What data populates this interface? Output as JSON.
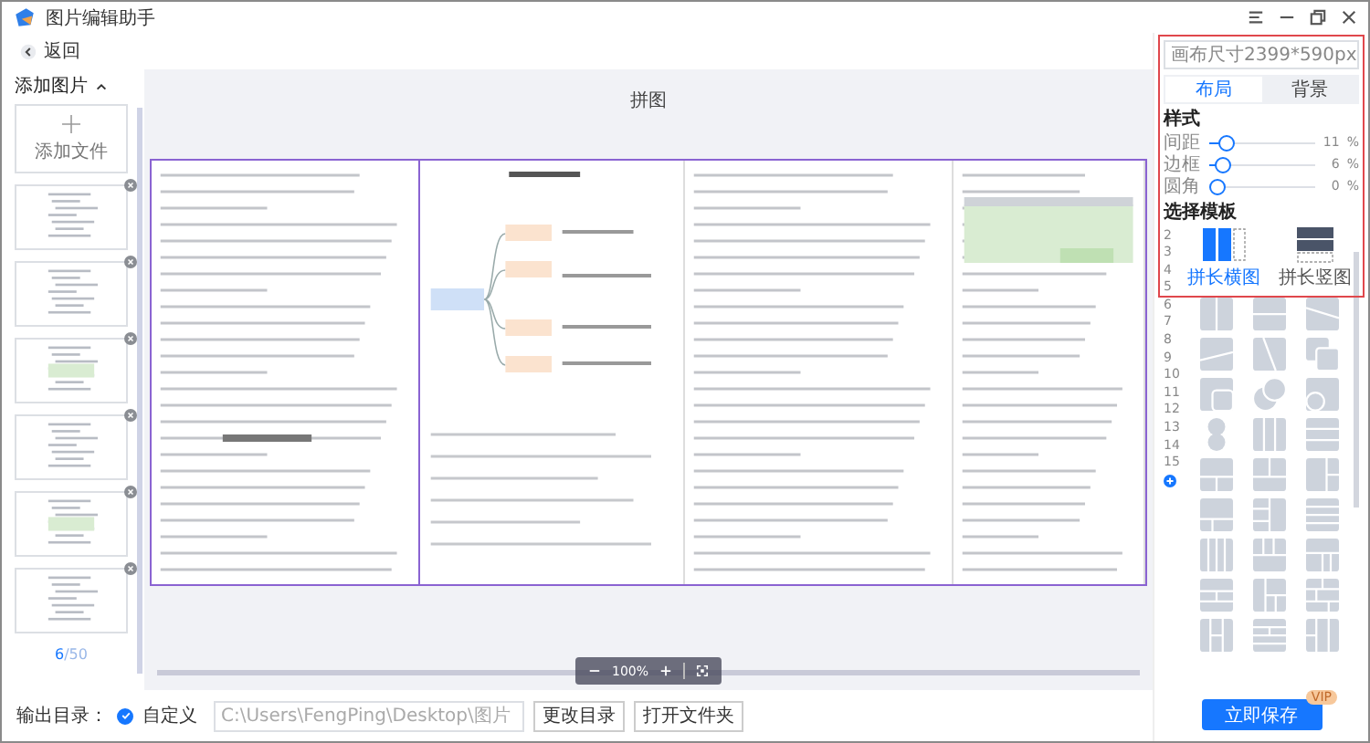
{
  "window": {
    "title": "图片编辑助手"
  },
  "back": {
    "label": "返回"
  },
  "sidebar": {
    "heading": "添加图片",
    "expanded": true,
    "add_button": "添加文件",
    "page_current": "6",
    "page_total": "/50"
  },
  "canvas": {
    "title": "拼图",
    "zoom": "100%"
  },
  "output": {
    "label": "输出目录：",
    "custom": {
      "label": "自定义",
      "checked": true
    },
    "path": "C:\\Users\\FengPing\\Desktop\\图片",
    "buttons": [
      "更改目录",
      "打开文件夹"
    ]
  },
  "panel": {
    "canvas_size": "画布尺寸2399*590px",
    "tabs": [
      {
        "label": "布局",
        "selected": true
      },
      {
        "label": "背景",
        "selected": false
      }
    ],
    "style_heading": "样式",
    "sliders": [
      {
        "label": "间距",
        "level": 0.11,
        "reading": "11",
        "unit": "%"
      },
      {
        "label": "边框",
        "level": 0.06,
        "reading": "6",
        "unit": "%"
      },
      {
        "label": "圆角",
        "level": 0,
        "reading": "0",
        "unit": "%"
      }
    ],
    "template_heading": "选择模板",
    "counts": [
      "2",
      "3",
      "4",
      "5",
      "6",
      "7",
      "8",
      "9",
      "10",
      "11",
      "12",
      "13",
      "14",
      "15"
    ],
    "featured": [
      {
        "label": "拼长横图",
        "kind": "horizontal",
        "selected": true
      },
      {
        "label": "拼长竖图",
        "kind": "vertical",
        "selected": false
      }
    ],
    "templates": [
      {
        "kind": "v2"
      },
      {
        "kind": "h2"
      },
      {
        "kind": "diag-a"
      },
      {
        "kind": "diag-b"
      },
      {
        "kind": "diag-c"
      },
      {
        "kind": "overlap"
      },
      {
        "kind": "corner"
      },
      {
        "kind": "circles"
      },
      {
        "kind": "circle-corner"
      },
      {
        "kind": "circles-v"
      },
      {
        "kind": "v3"
      },
      {
        "kind": "h3"
      },
      {
        "kind": "t1b2"
      },
      {
        "kind": "t2b1"
      },
      {
        "kind": "l1r2"
      },
      {
        "kind": "t1b2b"
      },
      {
        "kind": "l2r1"
      },
      {
        "kind": "h4"
      },
      {
        "kind": "v4"
      },
      {
        "kind": "t3b1"
      },
      {
        "kind": "t1b3"
      },
      {
        "kind": "m-h"
      },
      {
        "kind": "l-mix"
      },
      {
        "kind": "brick"
      },
      {
        "kind": "v-split-h"
      },
      {
        "kind": "h-mix"
      },
      {
        "kind": "v3h"
      }
    ],
    "save": "立即保存",
    "badge": "VIP"
  }
}
